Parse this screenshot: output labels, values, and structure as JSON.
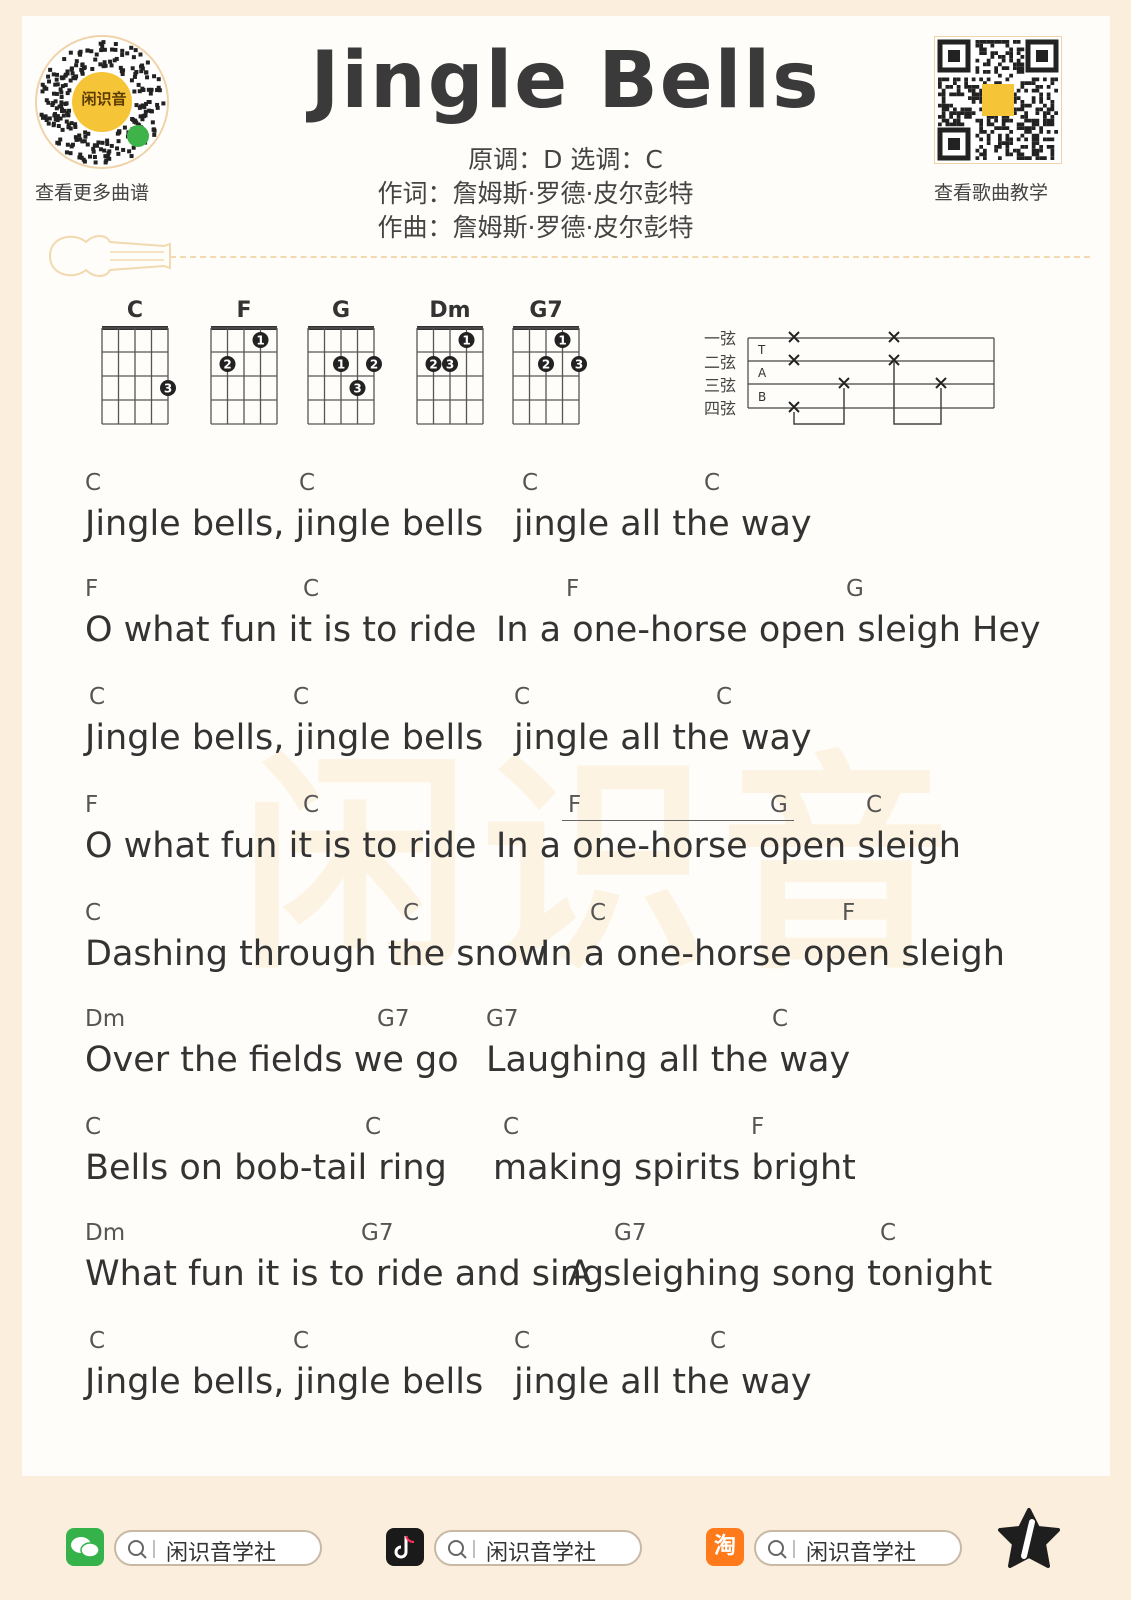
{
  "header": {
    "title": "Jingle Bells",
    "key_line": "原调：D   选调：C",
    "lyricist_line": "作词：詹姆斯·罗德·皮尔彭特",
    "composer_line": "作曲：詹姆斯·罗德·皮尔彭特",
    "left_qr_label": "查看更多曲谱",
    "right_qr_label": "查看歌曲教学",
    "qr_logo_text": "闲识音"
  },
  "watermark": "闲识音",
  "chords": [
    {
      "name": "C",
      "dots": [
        [
          3,
          4,
          "3"
        ]
      ]
    },
    {
      "name": "F",
      "dots": [
        [
          1,
          3,
          "1"
        ],
        [
          2,
          1,
          "2"
        ]
      ]
    },
    {
      "name": "G",
      "dots": [
        [
          2,
          2,
          "1"
        ],
        [
          2,
          4,
          "2"
        ],
        [
          3,
          3,
          "3"
        ]
      ]
    },
    {
      "name": "Dm",
      "dots": [
        [
          1,
          3,
          "1"
        ],
        [
          2,
          1,
          "2"
        ],
        [
          2,
          2,
          "3"
        ]
      ]
    },
    {
      "name": "G7",
      "dots": [
        [
          1,
          3,
          "1"
        ],
        [
          2,
          2,
          "2"
        ],
        [
          2,
          4,
          "3"
        ]
      ]
    }
  ],
  "tab": {
    "string_labels": [
      "一弦",
      "二弦",
      "三弦",
      "四弦"
    ],
    "tab_letters": [
      "T",
      "A",
      "B"
    ]
  },
  "lines": [
    {
      "left": {
        "text": "Jingle bells, jingle bells",
        "chords": [
          [
            "C",
            0
          ],
          [
            "C",
            214
          ]
        ]
      },
      "right": {
        "text": "jingle all the way",
        "chords": [
          [
            "C",
            8
          ],
          [
            "C",
            190
          ]
        ]
      }
    },
    {
      "left": {
        "text": "O what fun it is to ride",
        "chords": [
          [
            "F",
            0
          ],
          [
            "C",
            218
          ]
        ]
      },
      "right": {
        "text": "In a one-horse open sleigh Hey",
        "chords": [
          [
            "F",
            70
          ],
          [
            "G",
            350
          ]
        ]
      }
    },
    {
      "left": {
        "text": "Jingle bells, jingle bells",
        "chords": [
          [
            "C",
            4
          ],
          [
            "C",
            208
          ]
        ]
      },
      "right": {
        "text": "jingle all the way",
        "chords": [
          [
            "C",
            0
          ],
          [
            "C",
            202
          ]
        ]
      }
    },
    {
      "left": {
        "text": "O what fun it is to ride",
        "chords": [
          [
            "F",
            0
          ],
          [
            "C",
            218
          ]
        ]
      },
      "right": {
        "text": "In a one-horse open sleigh",
        "chords": [
          [
            "F",
            72
          ],
          [
            "G",
            274
          ],
          [
            "C",
            370
          ]
        ]
      }
    },
    {
      "left": {
        "text": "Dashing through the snow",
        "chords": [
          [
            "C",
            0
          ],
          [
            "C",
            318
          ]
        ]
      },
      "right": {
        "text": "In a one-horse open sleigh",
        "chords": [
          [
            "C",
            50
          ],
          [
            "F",
            302
          ]
        ]
      }
    },
    {
      "left": {
        "text": "Over the fields we go",
        "chords": [
          [
            "Dm",
            0
          ],
          [
            "G7",
            292
          ]
        ]
      },
      "right": {
        "text": "Laughing all the way",
        "chords": [
          [
            "G7",
            0
          ],
          [
            "C",
            286
          ]
        ]
      }
    },
    {
      "left": {
        "text": "Bells on bob-tail ring",
        "chords": [
          [
            "C",
            0
          ],
          [
            "C",
            280
          ]
        ]
      },
      "right": {
        "text": "making spirits bright",
        "chords": [
          [
            "C",
            10
          ],
          [
            "F",
            258
          ]
        ]
      }
    },
    {
      "left": {
        "text": "What fun it is to ride and sing",
        "chords": [
          [
            "Dm",
            0
          ],
          [
            "G7",
            276
          ]
        ]
      },
      "right": {
        "text": "A sleighing song tonight",
        "chords": [
          [
            "G7",
            46
          ],
          [
            "C",
            312
          ]
        ]
      }
    },
    {
      "left": {
        "text": "Jingle bells, jingle bells",
        "chords": [
          [
            "C",
            4
          ],
          [
            "C",
            208
          ]
        ]
      },
      "right": {
        "text": "jingle all the way",
        "chords": [
          [
            "C",
            0
          ],
          [
            "C",
            196
          ]
        ]
      }
    }
  ],
  "footer": {
    "wechat_label": "闲识音学社",
    "douyin_label": "闲识音学社",
    "taobao_label": "闲识音学社",
    "taobao_icon_text": "淘"
  }
}
